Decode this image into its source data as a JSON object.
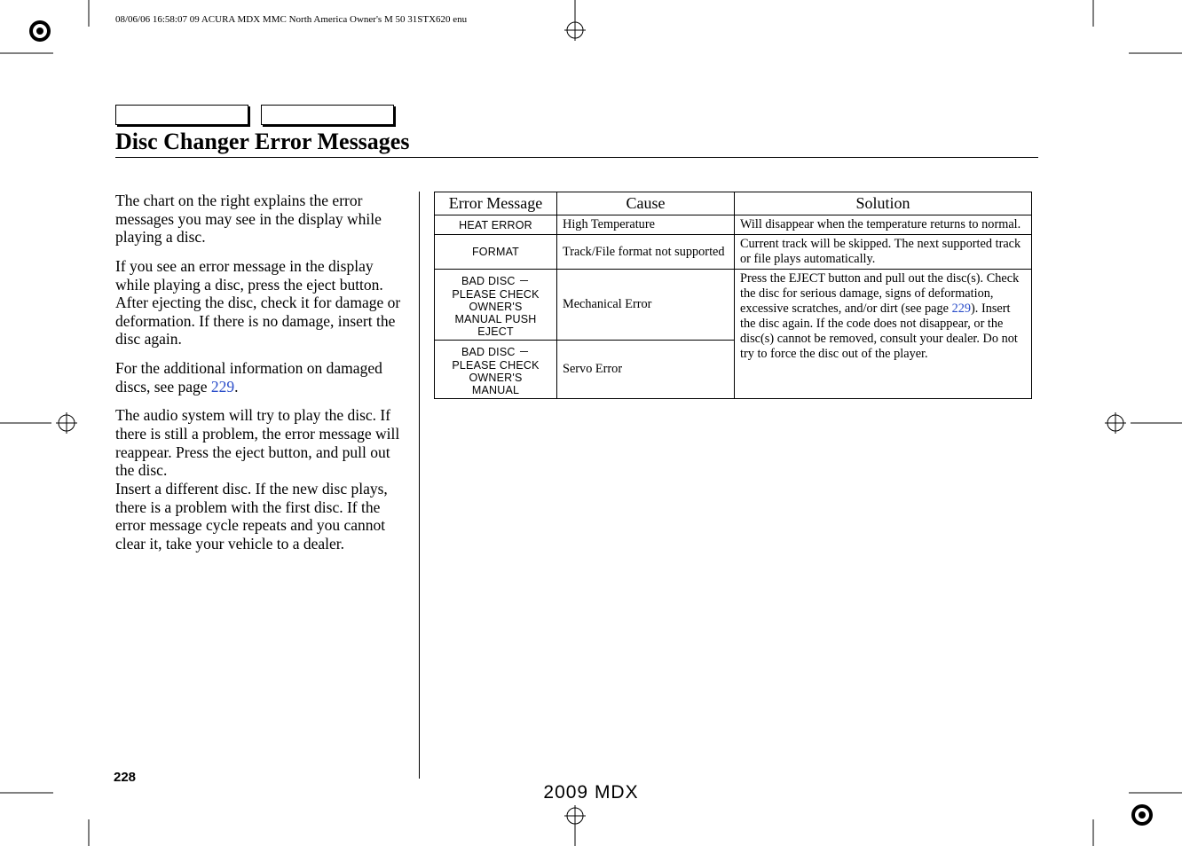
{
  "header": "08/06/06 16:58:07   09 ACURA MDX MMC North America Owner's M 50 31STX620 enu",
  "title": "Disc Changer Error Messages",
  "body": {
    "p1": "The chart on the right explains the error messages you may see in the display while playing a disc.",
    "p2": "If you see an error message in the display while playing a disc, press the eject button. After ejecting the disc, check it for damage or deformation. If there is no damage, insert the disc again.",
    "p3a": "For the additional information on damaged discs, see page ",
    "p3_link": "229",
    "p3b": ".",
    "p4": "The audio system will try to play the disc. If there is still a problem, the error message will reappear. Press the eject button, and pull out the disc.",
    "p5": "Insert a different disc. If the new disc plays, there is a problem with the first disc. If the error message cycle repeats and you cannot clear it, take your vehicle to a dealer."
  },
  "table": {
    "headers": {
      "c1": "Error Message",
      "c2": "Cause",
      "c3": "Solution"
    },
    "rows": [
      {
        "msg": "HEAT ERROR",
        "cause": "High Temperature",
        "sol": "Will disappear when the temperature returns to normal."
      },
      {
        "msg": "FORMAT",
        "cause": "Track/File format not supported",
        "sol": "Current track will be skipped. The next supported track or file plays automatically."
      },
      {
        "msg": "BAD DISC －\nPLEASE CHECK\nOWNER'S\nMANUAL PUSH\nEJECT",
        "cause": "Mechanical Error",
        "sol_a": "Press the EJECT button and pull out the disc(s). Check the disc for serious damage, signs of deformation, excessive scratches, and/or dirt (see page ",
        "sol_link": "229",
        "sol_b": "). Insert the disc again. If the code does not disappear, or the disc(s) cannot be removed, consult your dealer. Do not try to force the disc out of the player."
      },
      {
        "msg": "BAD DISC －\nPLEASE CHECK\nOWNER'S\nMANUAL",
        "cause": "Servo Error"
      }
    ]
  },
  "page_number": "228",
  "footer_model": "2009  MDX"
}
